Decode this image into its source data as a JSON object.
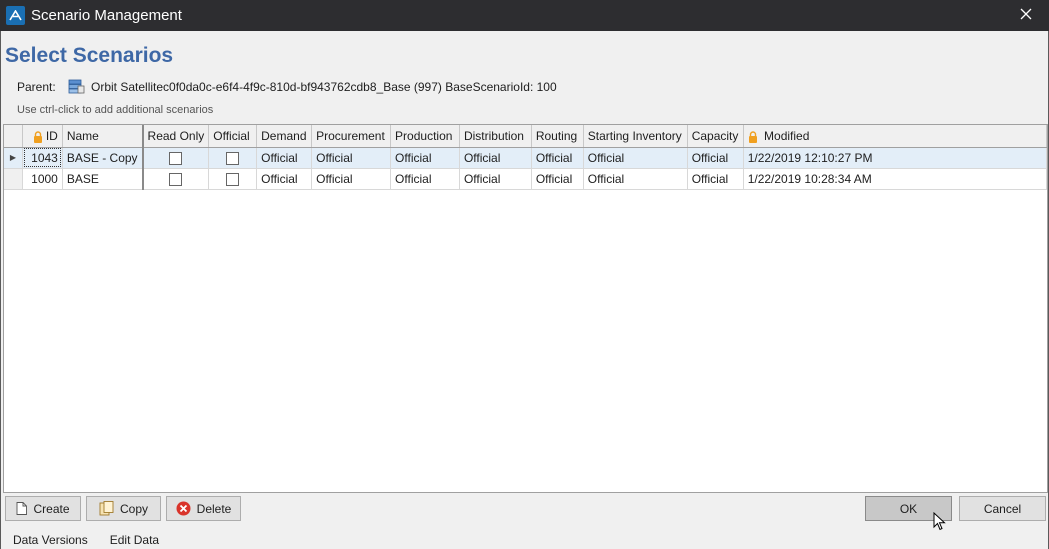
{
  "window": {
    "title": "Scenario Management",
    "close_glyph": "✕"
  },
  "heading": "Select Scenarios",
  "parent": {
    "label": "Parent:",
    "icon": "database-icon",
    "value": "Orbit Satellitec0f0da0c-e6f4-4f9c-810d-bf943762cdb8_Base (997) BaseScenarioId: 100"
  },
  "hint": "Use ctrl-click to add additional scenarios",
  "grid": {
    "columns": [
      {
        "key": "id",
        "label": "ID",
        "locked": true
      },
      {
        "key": "name",
        "label": "Name"
      },
      {
        "key": "read_only",
        "label": "Read Only"
      },
      {
        "key": "official",
        "label": "Official"
      },
      {
        "key": "demand",
        "label": "Demand"
      },
      {
        "key": "procurement",
        "label": "Procurement"
      },
      {
        "key": "production",
        "label": "Production"
      },
      {
        "key": "distribution",
        "label": "Distribution"
      },
      {
        "key": "routing",
        "label": "Routing"
      },
      {
        "key": "starting_inventory",
        "label": "Starting Inventory"
      },
      {
        "key": "capacity",
        "label": "Capacity"
      },
      {
        "key": "modified",
        "label": "Modified",
        "locked": true
      }
    ],
    "rows": [
      {
        "current": true,
        "selected": true,
        "id": "1043",
        "name": "BASE - Copy",
        "read_only": false,
        "official": false,
        "demand": "Official",
        "procurement": "Official",
        "production": "Official",
        "distribution": "Official",
        "routing": "Official",
        "starting_inventory": "Official",
        "capacity": "Official",
        "modified": "1/22/2019 12:10:27 PM"
      },
      {
        "current": false,
        "selected": false,
        "id": "1000",
        "name": "BASE",
        "read_only": false,
        "official": false,
        "demand": "Official",
        "procurement": "Official",
        "production": "Official",
        "distribution": "Official",
        "routing": "Official",
        "starting_inventory": "Official",
        "capacity": "Official",
        "modified": "1/22/2019 10:28:34 AM"
      }
    ]
  },
  "buttons": {
    "create": "Create",
    "copy": "Copy",
    "delete": "Delete",
    "ok": "OK",
    "cancel": "Cancel"
  },
  "footer": {
    "data_versions": "Data Versions",
    "edit_data": "Edit Data"
  },
  "colors": {
    "heading": "#3e68a6",
    "titlebar": "#2d2d30",
    "selected_row": "#e3eef8",
    "lock": "#f0a020",
    "delete_icon": "#d9342b"
  }
}
